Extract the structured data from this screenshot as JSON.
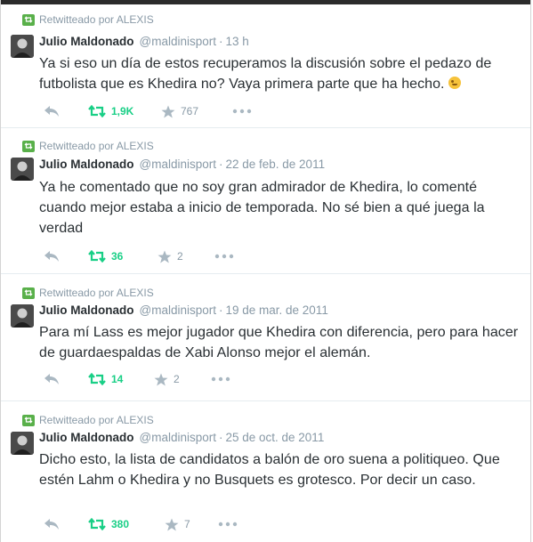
{
  "tweets": [
    {
      "retweeted_by": "Retwitteado por ALEXIS",
      "name": "Julio Maldonado",
      "handle": "@maldinisport",
      "separator": "·",
      "time": "13 h",
      "text": "Ya si eso un día de estos recuperamos la discusión sobre el pedazo de futbolista que es Khedira no? Vaya primera parte que ha hecho.",
      "has_emoji": true,
      "retweets": "1,9K",
      "favorites": "767"
    },
    {
      "retweeted_by": "Retwitteado por ALEXIS",
      "name": "Julio Maldonado",
      "handle": "@maldinisport",
      "separator": "·",
      "time": "22 de feb. de 2011",
      "text": "Ya he comentado que no soy gran admirador de Khedira, lo comenté cuando mejor estaba a inicio de temporada. No sé bien a qué juega la verdad",
      "retweets": "36",
      "favorites": "2"
    },
    {
      "retweeted_by": "Retwitteado por ALEXIS",
      "name": "Julio Maldonado",
      "handle": "@maldinisport",
      "separator": "·",
      "time": "19 de mar. de 2011",
      "text": "Para mí Lass es mejor jugador que Khedira con diferencia, pero para hacer de guardaespaldas de Xabi Alonso mejor el alemán.",
      "retweets": "14",
      "favorites": "2"
    },
    {
      "retweeted_by": "Retwitteado por ALEXIS",
      "name": "Julio Maldonado",
      "handle": "@maldinisport",
      "separator": "·",
      "time": "25 de oct. de 2011",
      "text": "Dicho esto, la lista de candidatos a balón de oro suena a politiqueo. Que estén Lahm o Khedira y no Busquets es grotesco. Por decir un caso.",
      "retweets": "380",
      "favorites": "7"
    }
  ],
  "icons": {
    "retweet_badge": "retweet-badge-icon",
    "reply": "reply-icon",
    "retweet": "retweet-icon",
    "favorite": "star-icon",
    "more": "more-icon",
    "emoji": "winking-face-icon"
  },
  "colors": {
    "retweet_green": "#19cf86",
    "badge_green": "#59b04a",
    "muted": "#8899a6",
    "text": "#292f33",
    "action_gray": "#aab8c2"
  }
}
